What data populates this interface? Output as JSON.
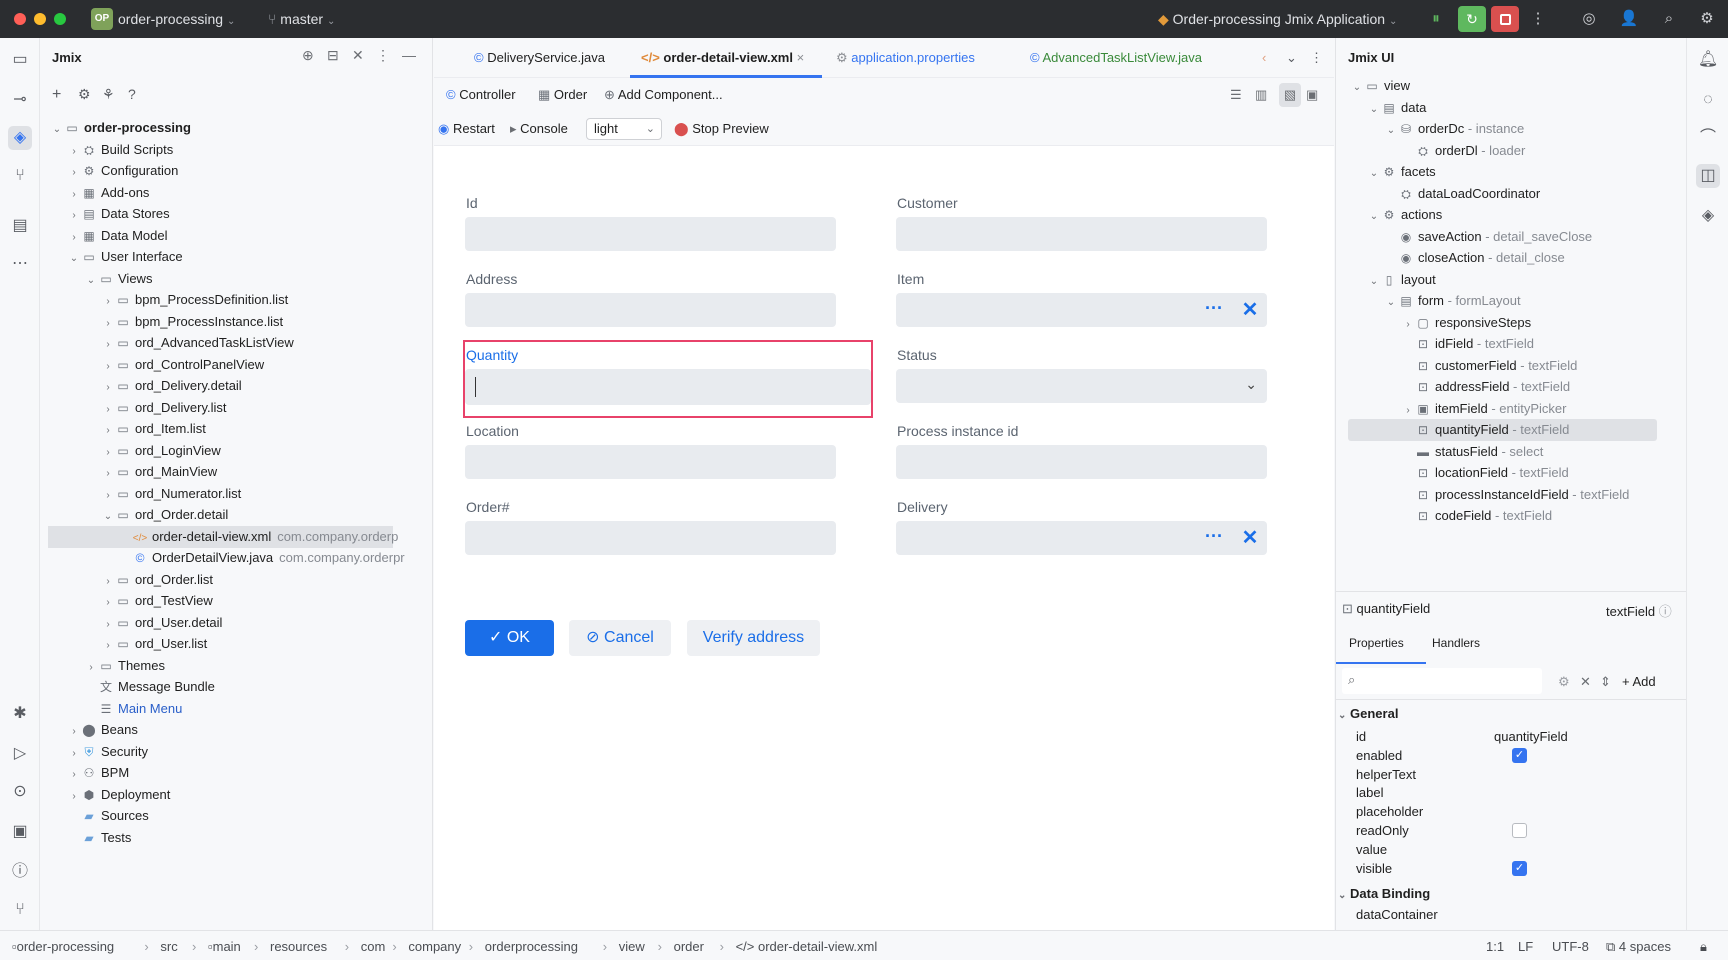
{
  "titlebar": {
    "project_badge": "OP",
    "project": "order-processing",
    "branch": "master",
    "run_config": "Order-processing Jmix Application"
  },
  "project_panel": {
    "title": "Jmix",
    "items": [
      {
        "label": "order-processing",
        "bold": true
      },
      {
        "label": "Build Scripts"
      },
      {
        "label": "Configuration"
      },
      {
        "label": "Add-ons"
      },
      {
        "label": "Data Stores"
      },
      {
        "label": "Data Model"
      },
      {
        "label": "User Interface"
      },
      {
        "label": "Views"
      },
      {
        "label": "bpm_ProcessDefinition.list"
      },
      {
        "label": "bpm_ProcessInstance.list"
      },
      {
        "label": "ord_AdvancedTaskListView"
      },
      {
        "label": "ord_ControlPanelView"
      },
      {
        "label": "ord_Delivery.detail"
      },
      {
        "label": "ord_Delivery.list"
      },
      {
        "label": "ord_Item.list"
      },
      {
        "label": "ord_LoginView"
      },
      {
        "label": "ord_MainView"
      },
      {
        "label": "ord_Numerator.list"
      },
      {
        "label": "ord_Order.detail"
      },
      {
        "label": "order-detail-view.xml",
        "muted": "com.company.orderp"
      },
      {
        "label": "OrderDetailView.java",
        "muted": "com.company.orderpr"
      },
      {
        "label": "ord_Order.list"
      },
      {
        "label": "ord_TestView"
      },
      {
        "label": "ord_User.detail"
      },
      {
        "label": "ord_User.list"
      },
      {
        "label": "Themes"
      },
      {
        "label": "Message Bundle"
      },
      {
        "label": "Main Menu"
      },
      {
        "label": "Beans"
      },
      {
        "label": "Security"
      },
      {
        "label": "BPM"
      },
      {
        "label": "Deployment"
      },
      {
        "label": "Sources"
      },
      {
        "label": "Tests"
      }
    ]
  },
  "editor": {
    "tabs": [
      "DeliveryService.java",
      "order-detail-view.xml",
      "application.properties",
      "AdvancedTaskListView.java"
    ],
    "toolbar": {
      "controller": "Controller",
      "order": "Order",
      "add_component": "Add Component...",
      "restart": "Restart",
      "console": "Console",
      "theme": "light",
      "stop": "Stop Preview"
    },
    "form": {
      "id": "Id",
      "customer": "Customer",
      "address": "Address",
      "item": "Item",
      "quantity": "Quantity",
      "status": "Status",
      "location": "Location",
      "process": "Process instance id",
      "order_no": "Order#",
      "delivery": "Delivery"
    },
    "buttons": {
      "ok": "OK",
      "cancel": "Cancel",
      "verify": "Verify address"
    }
  },
  "jmix_ui": {
    "title": "Jmix UI",
    "tree": [
      {
        "name": "view",
        "detail": ""
      },
      {
        "name": "data",
        "detail": ""
      },
      {
        "name": "orderDc",
        "detail": " - instance"
      },
      {
        "name": "orderDl",
        "detail": " - loader"
      },
      {
        "name": "facets",
        "detail": ""
      },
      {
        "name": "dataLoadCoordinator",
        "detail": ""
      },
      {
        "name": "actions",
        "detail": ""
      },
      {
        "name": "saveAction",
        "detail": " - detail_saveClose"
      },
      {
        "name": "closeAction",
        "detail": " - detail_close"
      },
      {
        "name": "layout",
        "detail": ""
      },
      {
        "name": "form",
        "detail": " - formLayout"
      },
      {
        "name": "responsiveSteps",
        "detail": ""
      },
      {
        "name": "idField",
        "detail": " - textField"
      },
      {
        "name": "customerField",
        "detail": " - textField"
      },
      {
        "name": "addressField",
        "detail": " - textField"
      },
      {
        "name": "itemField",
        "detail": " - entityPicker"
      },
      {
        "name": "quantityField",
        "detail": " - textField"
      },
      {
        "name": "statusField",
        "detail": " - select"
      },
      {
        "name": "locationField",
        "detail": " - textField"
      },
      {
        "name": "processInstanceIdField",
        "detail": " - textField"
      },
      {
        "name": "codeField",
        "detail": " - textField"
      }
    ],
    "selected_component": "quantityField",
    "selected_type": "textField",
    "tab_properties": "Properties",
    "tab_handlers": "Handlers",
    "add": "Add",
    "group_general": "General",
    "group_binding": "Data Binding",
    "props": [
      {
        "name": "id",
        "value": "quantityField",
        "check": null
      },
      {
        "name": "enabled",
        "value": "",
        "check": true
      },
      {
        "name": "helperText",
        "value": "",
        "check": null
      },
      {
        "name": "label",
        "value": "",
        "check": null
      },
      {
        "name": "placeholder",
        "value": "",
        "check": null
      },
      {
        "name": "readOnly",
        "value": "",
        "check": false
      },
      {
        "name": "value",
        "value": "",
        "check": null
      },
      {
        "name": "visible",
        "value": "",
        "check": true
      }
    ],
    "binding_props": [
      "dataContainer"
    ]
  },
  "statusbar": {
    "path": [
      "order-processing",
      "src",
      "main",
      "resources",
      "com",
      "company",
      "orderprocessing",
      "view",
      "order",
      "order-detail-view.xml"
    ],
    "pos": "1:1",
    "le": "LF",
    "enc": "UTF-8",
    "indent": "4 spaces"
  },
  "colors": {
    "accent": "#1a6ee8",
    "selected_border": "#e8426a",
    "project_badge": "#7fa25a"
  }
}
